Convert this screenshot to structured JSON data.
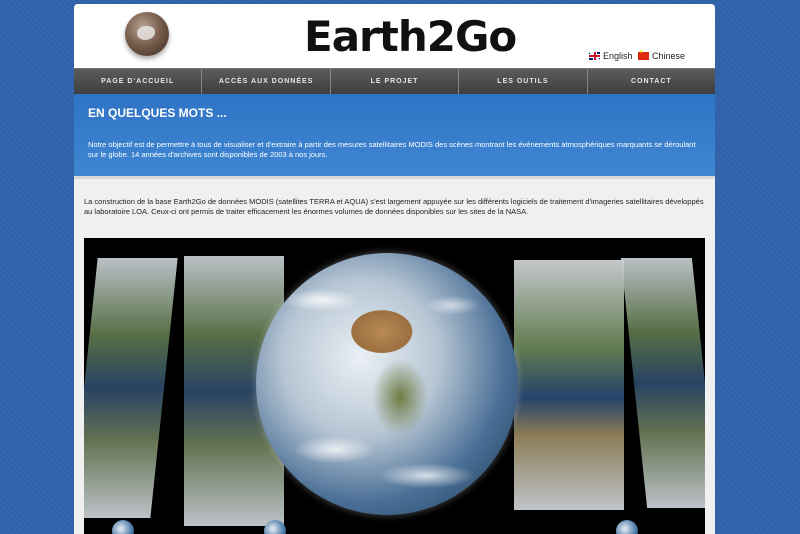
{
  "header": {
    "title": "Earth2Go",
    "languages": [
      {
        "label": "English",
        "flag": "uk-flag-icon"
      },
      {
        "label": "Chinese",
        "flag": "china-flag-icon"
      }
    ]
  },
  "nav": {
    "items": [
      "PAGE D'ACCUEIL",
      "ACCÈS AUX DONNÉES",
      "LE PROJET",
      "LES OUTILS",
      "CONTACT"
    ]
  },
  "banner": {
    "heading": "EN QUELQUES MOTS ...",
    "text": "Notre objectif est de permettre à tous de visualiser et d'extraire à partir des mesures satellitaires MODIS des scènes montrant les événements atmosphériques marquants se déroulant sur le globe. 14 années d'archives sont disponibles de 2003 à nos jours."
  },
  "intro": {
    "text": "La construction de la base Earth2Go de données MODIS (satellites TERRA et AQUA) s'est largement appuyée sur les différents logiciels de traitement d'imageries satellitaires développés au laboratoire LOA. Ceux-ci ont permis de traiter efficacement les énormes volumes de données disponibles sur les sites de la NASA."
  },
  "colors": {
    "background": "#2f61a8",
    "banner": "#3a80cd",
    "nav": "#4a4a4a"
  }
}
